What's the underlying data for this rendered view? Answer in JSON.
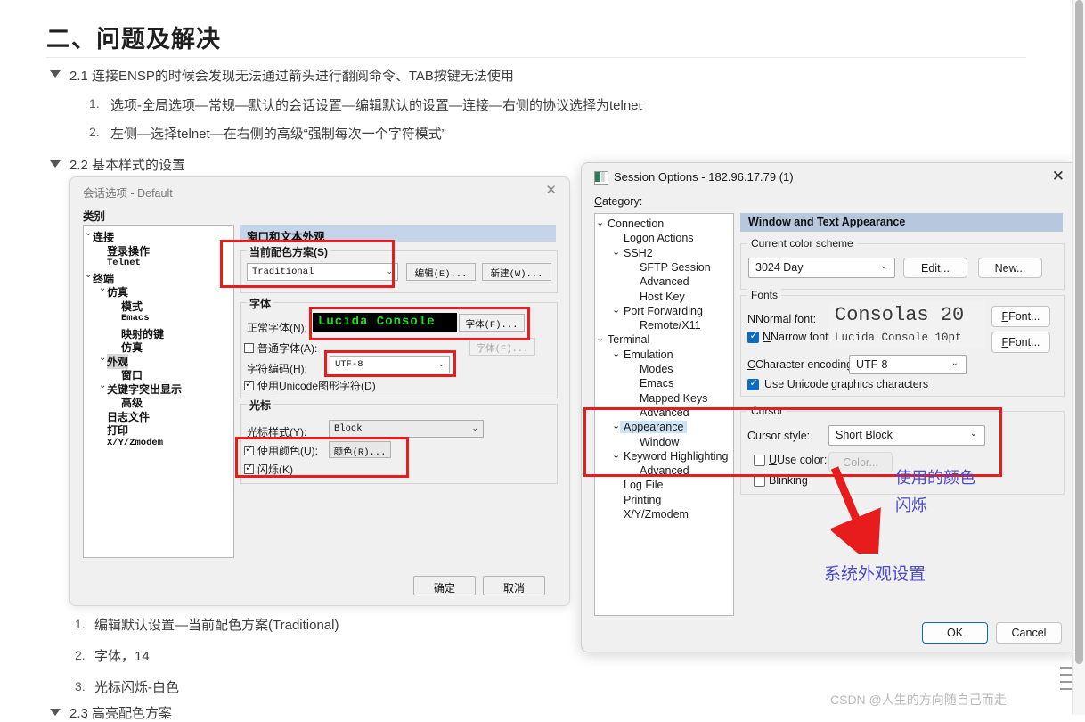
{
  "article": {
    "heading": "二、问题及解决",
    "sections": [
      {
        "marker": "▼",
        "text": "2.1 连接ENSP的时候会发现无法通过箭头进行翻阅命令、TAB按键无法使用"
      },
      {
        "marker": "▼",
        "text": "2.2 基本样式的设置"
      },
      {
        "marker": "▼",
        "text": "2.3 高亮配色方案"
      }
    ],
    "list_a": [
      {
        "num": "1.",
        "text": "选项-全局选项—常规—默认的会话设置—编辑默认的设置—连接—右侧的协议选择为telnet"
      },
      {
        "num": "2.",
        "text": "左侧—选择telnet—在右侧的高级“强制每次一个字符模式”"
      }
    ],
    "list_b": [
      {
        "num": "1.",
        "text": "编辑默认设置—当前配色方案(Traditional)"
      },
      {
        "num": "2.",
        "text": "字体，14"
      },
      {
        "num": "3.",
        "text": "光标闪烁-白色"
      }
    ],
    "watermark": "CSDN @人生的方向随自己而走"
  },
  "dialog1": {
    "title": "会话选项 - Default",
    "close_icon": "✕",
    "category_label": "类别",
    "tree": [
      {
        "label": "连接",
        "chevron": "⌄",
        "indent": 0,
        "mono": false,
        "selected": false
      },
      {
        "label": "登录操作",
        "chevron": "",
        "indent": 1,
        "mono": false,
        "selected": false
      },
      {
        "label": "Telnet",
        "chevron": "",
        "indent": 1,
        "mono": true,
        "selected": false
      },
      {
        "label": "终端",
        "chevron": "⌄",
        "indent": 0,
        "mono": false,
        "selected": false
      },
      {
        "label": "仿真",
        "chevron": "⌄",
        "indent": 1,
        "mono": false,
        "selected": false
      },
      {
        "label": "模式",
        "chevron": "",
        "indent": 2,
        "mono": false,
        "selected": false
      },
      {
        "label": "Emacs",
        "chevron": "",
        "indent": 2,
        "mono": true,
        "selected": false
      },
      {
        "label": "映射的键",
        "chevron": "",
        "indent": 2,
        "mono": false,
        "selected": false
      },
      {
        "label": "仿真",
        "chevron": "",
        "indent": 2,
        "mono": false,
        "selected": false
      },
      {
        "label": "外观",
        "chevron": "⌄",
        "indent": 1,
        "mono": false,
        "selected": true
      },
      {
        "label": "窗口",
        "chevron": "",
        "indent": 2,
        "mono": false,
        "selected": false
      },
      {
        "label": "关键字突出显示",
        "chevron": "⌄",
        "indent": 1,
        "mono": false,
        "selected": false
      },
      {
        "label": "高级",
        "chevron": "",
        "indent": 2,
        "mono": false,
        "selected": false
      },
      {
        "label": "日志文件",
        "chevron": "",
        "indent": 1,
        "mono": false,
        "selected": false
      },
      {
        "label": "打印",
        "chevron": "",
        "indent": 1,
        "mono": false,
        "selected": false
      },
      {
        "label": "X/Y/Zmodem",
        "chevron": "",
        "indent": 1,
        "mono": true,
        "selected": false
      }
    ],
    "pane_title": "窗口和文本外观",
    "scheme_group_label": "当前配色方案(S)",
    "scheme_value": "Traditional",
    "scheme_caret": "⌄",
    "edit_button": "编辑(E)...",
    "new_button": "新建(W)...",
    "fonts_group_label": "字体",
    "normal_font_label": "正常字体(N):",
    "normal_font_value": "Lucida Console",
    "normal_font_button": "字体(F)...",
    "plain_font_label": "普通字体(A):",
    "plain_font_button": "字体(F)...",
    "encoding_label": "字符编码(H):",
    "encoding_value": "UTF-8",
    "encoding_caret": "⌄",
    "unicode_label": "使用Unicode图形字符(D)",
    "cursor_group_label": "光标",
    "cursor_style_label": "光标样式(Y):",
    "cursor_style_value": "Block",
    "cursor_style_caret": "⌄",
    "use_color_label": "使用颜色(U):",
    "color_button": "颜色(R)...",
    "blink_label": "闪烁(K)",
    "ok_button": "确定",
    "cancel_button": "取消"
  },
  "dialog2": {
    "title": "Session Options - 182.96.17.79 (1)",
    "close_icon": "✕",
    "category_label": "Category:",
    "tree": [
      {
        "label": "Connection",
        "chevron": "⌄",
        "indent": 0,
        "highlighted": false
      },
      {
        "label": "Logon Actions",
        "chevron": "",
        "indent": 1,
        "highlighted": false
      },
      {
        "label": "SSH2",
        "chevron": "⌄",
        "indent": 1,
        "highlighted": false
      },
      {
        "label": "SFTP Session",
        "chevron": "",
        "indent": 2,
        "highlighted": false
      },
      {
        "label": "Advanced",
        "chevron": "",
        "indent": 2,
        "highlighted": false
      },
      {
        "label": "Host Key",
        "chevron": "",
        "indent": 2,
        "highlighted": false
      },
      {
        "label": "Port Forwarding",
        "chevron": "⌄",
        "indent": 1,
        "highlighted": false
      },
      {
        "label": "Remote/X11",
        "chevron": "",
        "indent": 2,
        "highlighted": false
      },
      {
        "label": "Terminal",
        "chevron": "⌄",
        "indent": 0,
        "highlighted": false
      },
      {
        "label": "Emulation",
        "chevron": "⌄",
        "indent": 1,
        "highlighted": false
      },
      {
        "label": "Modes",
        "chevron": "",
        "indent": 2,
        "highlighted": false
      },
      {
        "label": "Emacs",
        "chevron": "",
        "indent": 2,
        "highlighted": false
      },
      {
        "label": "Mapped Keys",
        "chevron": "",
        "indent": 2,
        "highlighted": false
      },
      {
        "label": "Advanced",
        "chevron": "",
        "indent": 2,
        "highlighted": false
      },
      {
        "label": "Appearance",
        "chevron": "⌄",
        "indent": 1,
        "highlighted": true
      },
      {
        "label": "Window",
        "chevron": "",
        "indent": 2,
        "highlighted": false
      },
      {
        "label": "Keyword Highlighting",
        "chevron": "⌄",
        "indent": 1,
        "highlighted": false
      },
      {
        "label": "Advanced",
        "chevron": "",
        "indent": 2,
        "highlighted": false
      },
      {
        "label": "Log File",
        "chevron": "",
        "indent": 1,
        "highlighted": false
      },
      {
        "label": "Printing",
        "chevron": "",
        "indent": 1,
        "highlighted": false
      },
      {
        "label": "X/Y/Zmodem",
        "chevron": "",
        "indent": 1,
        "highlighted": false
      }
    ],
    "pane_title": "Window and Text Appearance",
    "scheme_group_label": "Current color scheme",
    "scheme_value": "3024 Day",
    "scheme_caret": "⌄",
    "edit_button": "Edit...",
    "new_button": "New...",
    "fonts_group_label": "Fonts",
    "normal_font_label": "Normal font:",
    "normal_font_value": "Consolas 20",
    "normal_font_button": "Font...",
    "narrow_font_label": "Narrow font:",
    "narrow_font_value": "Lucida Console 10pt",
    "narrow_font_button": "Font...",
    "encoding_label": "Character encoding:",
    "encoding_value": "UTF-8",
    "encoding_caret": "⌄",
    "unicode_label": "Use Unicode graphics characters",
    "cursor_group_label": "Cursor",
    "cursor_style_label": "Cursor style:",
    "cursor_style_value": "Short Block",
    "cursor_style_caret": "⌄",
    "use_color_label": "Use color:",
    "color_button": "Color...",
    "blinking_label": "Blinking",
    "ok_button": "OK",
    "cancel_button": "Cancel"
  },
  "annotations": {
    "color_note_line1": "使用的颜色",
    "color_note_line2": "闪烁",
    "appearance_note": "系统外观设置",
    "accent_red": "#e81c1c",
    "accent_blue": "#4b49cf"
  }
}
